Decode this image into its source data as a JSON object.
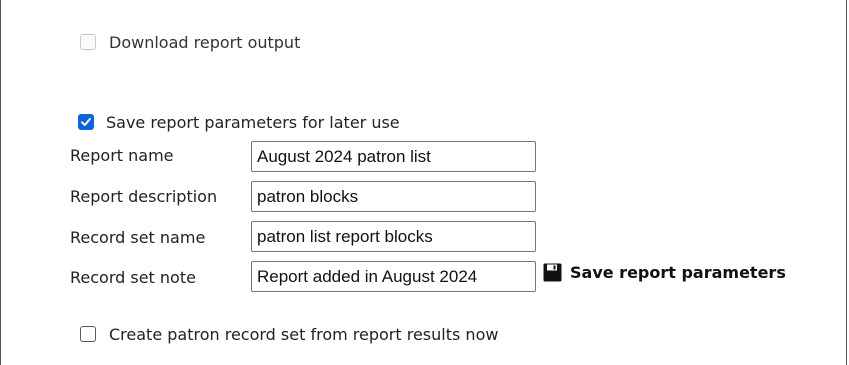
{
  "options": {
    "download_output": {
      "label": "Download report output",
      "checked": false,
      "disabled": true
    },
    "save_params": {
      "label": "Save report parameters for later use",
      "checked": true
    },
    "create_record_set": {
      "label": "Create patron record set from report results now",
      "checked": false
    }
  },
  "fields": {
    "report_name": {
      "label": "Report name",
      "value": "August 2024 patron list"
    },
    "report_description": {
      "label": "Report description",
      "value": "patron blocks"
    },
    "record_set_name": {
      "label": "Record set name",
      "value": "patron list report blocks"
    },
    "record_set_note": {
      "label": "Record set note",
      "value": "Report added in August 2024"
    }
  },
  "save_button": {
    "label": "Save report parameters",
    "icon": "floppy-disk-icon"
  },
  "colors": {
    "checkbox_accent": "#0b66d8",
    "border": "#555555"
  }
}
